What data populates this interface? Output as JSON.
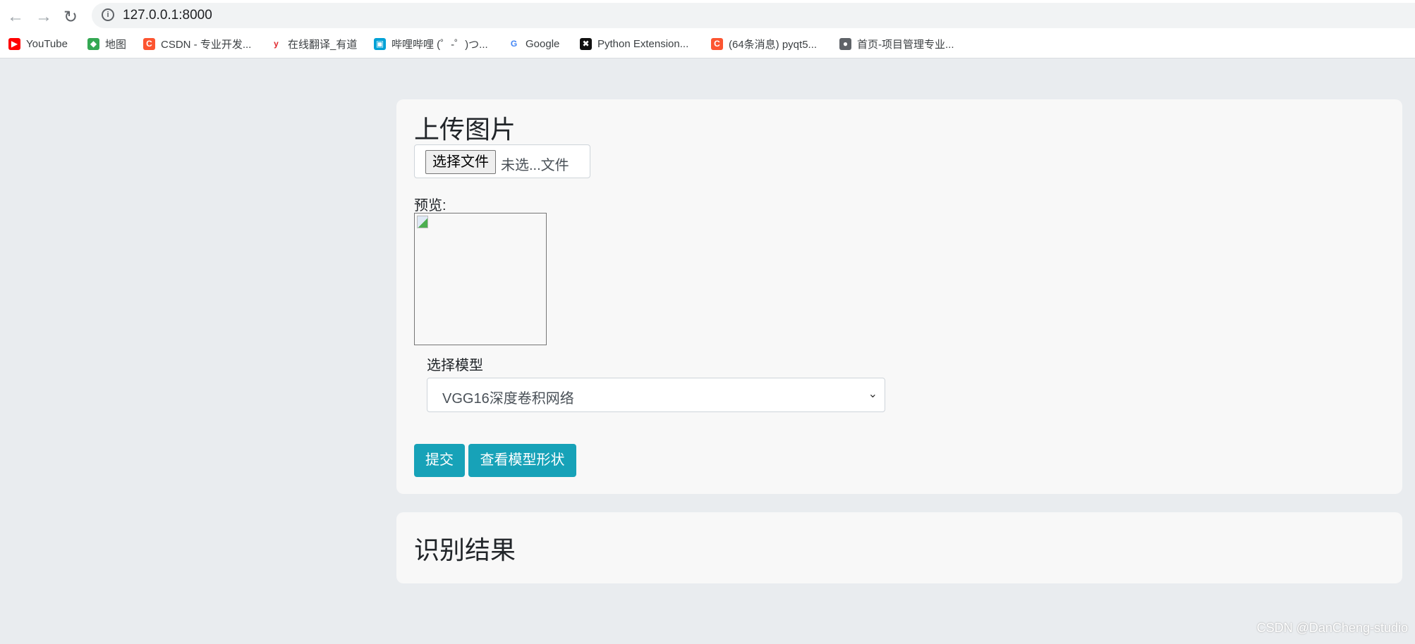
{
  "browser": {
    "url": "127.0.0.1:8000",
    "bookmarks": [
      {
        "label": "YouTube",
        "icon": "youtube-icon",
        "color": "#ff0000",
        "glyph": "▶"
      },
      {
        "label": "地图",
        "icon": "maps-icon",
        "color": "#34a853",
        "glyph": "◆"
      },
      {
        "label": "CSDN - 专业开发...",
        "icon": "csdn-icon",
        "color": "#fc5531",
        "glyph": "C"
      },
      {
        "label": "在线翻译_有道",
        "icon": "youdao-icon",
        "color": "#ffffff",
        "glyph": "y"
      },
      {
        "label": "哔哩哔哩 (゜-゜)つ...",
        "icon": "bilibili-icon",
        "color": "#00a1d6",
        "glyph": "▣"
      },
      {
        "label": "Google",
        "icon": "google-icon",
        "color": "#ffffff",
        "glyph": "G"
      },
      {
        "label": "Python Extension...",
        "icon": "python-extension-icon",
        "color": "#111111",
        "glyph": "✖"
      },
      {
        "label": "(64条消息) pyqt5...",
        "icon": "csdn-icon",
        "color": "#fc5531",
        "glyph": "C"
      },
      {
        "label": "首页-项目管理专业...",
        "icon": "globe-icon",
        "color": "#5f6368",
        "glyph": "●"
      }
    ]
  },
  "upload": {
    "title": "上传图片",
    "choose_file": "选择文件",
    "no_file": "未选...文件",
    "preview_label": "预览:",
    "model_label": "选择模型",
    "model_selected": "VGG16深度卷积网络",
    "submit": "提交",
    "view_shape": "查看模型形状"
  },
  "result": {
    "title": "识别结果"
  },
  "watermark": "CSDN @DanCheng-studio",
  "colors": {
    "accent": "#17a2b8",
    "background": "#e9ecef",
    "card": "#f8f8f8"
  }
}
